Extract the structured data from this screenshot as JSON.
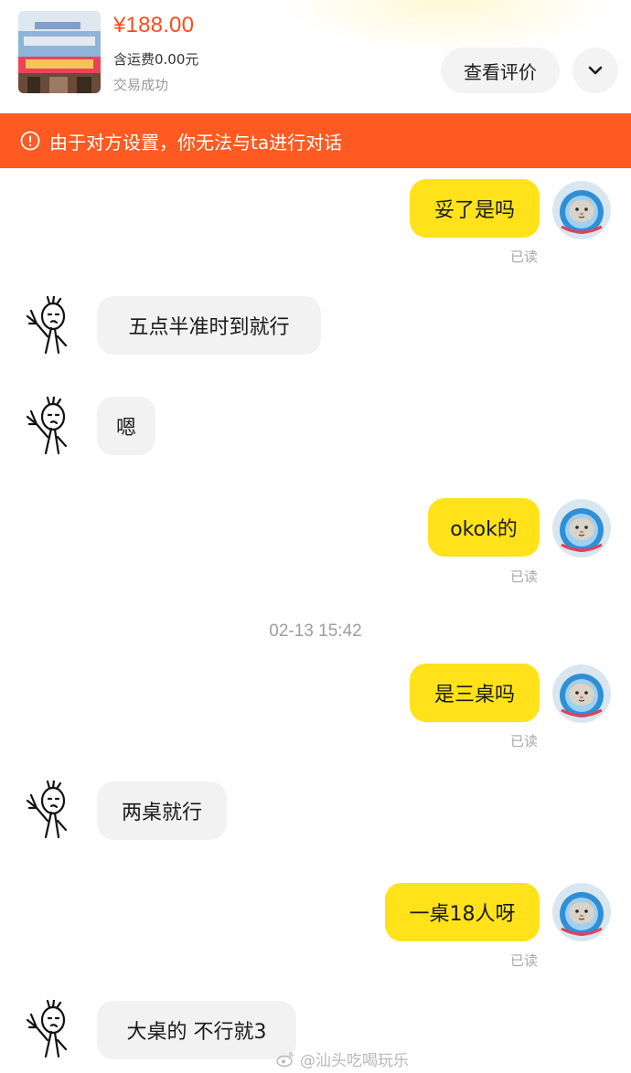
{
  "order": {
    "price": "¥188.00",
    "shipping": "含运费0.00元",
    "status": "交易成功",
    "thumbnail_icon": "restaurant-storefront-photo",
    "review_button": "查看评价",
    "collapse_icon": "chevron-down-icon"
  },
  "banner": {
    "icon": "warning-circle-icon",
    "text": "由于对方设置，你无法与ta进行对话",
    "color": "#ff5a22"
  },
  "colors": {
    "sent_bubble": "#ffe21a",
    "received_bubble": "#f2f2f2",
    "price": "#ff4a1c"
  },
  "messages": [
    {
      "from": "self",
      "text": "妥了是吗",
      "status": "已读"
    },
    {
      "from": "other",
      "text": "五点半准时到就行"
    },
    {
      "from": "other",
      "text": "嗯"
    },
    {
      "from": "self",
      "text": "okok的",
      "status": "已读"
    },
    {
      "from": "self",
      "text": "是三桌吗",
      "status": "已读"
    },
    {
      "from": "other",
      "text": "两桌就行"
    },
    {
      "from": "self",
      "text": "一桌18人呀",
      "status": "已读"
    },
    {
      "from": "other",
      "text": "大桌的 不行就3"
    }
  ],
  "timestamp": "02-13 15:42",
  "watermark": "@汕头吃喝玩乐"
}
